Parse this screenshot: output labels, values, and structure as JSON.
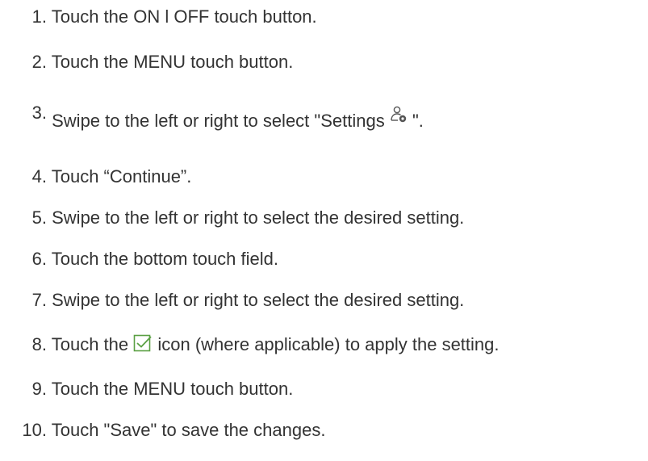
{
  "steps": [
    {
      "number": "1.",
      "text": "Touch the ON l OFF touch button."
    },
    {
      "number": "2.",
      "text": "Touch the MENU touch button."
    },
    {
      "number": "3.",
      "text_before": "Swipe to the left or right to select \"Settings ",
      "icon": "settings-person-gear-icon",
      "text_after": " \"."
    },
    {
      "number": "4.",
      "text": "Touch “Continue”."
    },
    {
      "number": "5.",
      "text": "Swipe to the left or right to select the desired setting."
    },
    {
      "number": "6.",
      "text": "Touch the bottom touch field."
    },
    {
      "number": "7.",
      "text": "Swipe to the left or right to select the desired setting."
    },
    {
      "number": "8.",
      "text_before": "Touch the ",
      "icon": "checkbox-check-icon",
      "text_after": " icon (where applicable) to apply the setting."
    },
    {
      "number": "9.",
      "text": "Touch the MENU touch button."
    },
    {
      "number": "10.",
      "text": "Touch \"Save\" to save the changes."
    }
  ],
  "colors": {
    "text": "#333333",
    "icon_checkbox": "#5aa043",
    "icon_settings": "#555555"
  }
}
